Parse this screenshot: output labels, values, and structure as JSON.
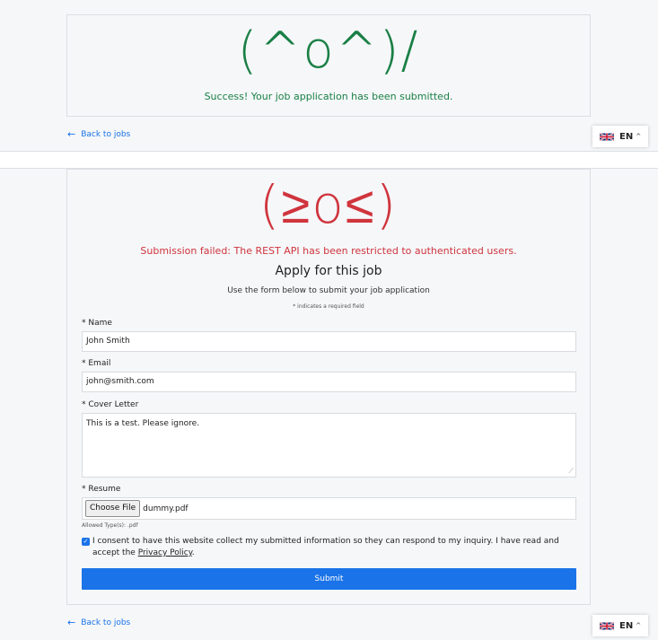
{
  "success_panel": {
    "emoticon": "(^o^)/",
    "message": "Success! Your job application has been submitted."
  },
  "fail_panel": {
    "emoticon": "(≥o≤)",
    "message": "Submission failed: The REST API has been restricted to authenticated users.",
    "title": "Apply for this job",
    "subtitle": "Use the form below to submit your job application",
    "required_note": "* indicates a required field"
  },
  "form": {
    "name_label": "* Name",
    "name_value": "John Smith",
    "email_label": "* Email",
    "email_value": "john@smith.com",
    "cover_label": "* Cover Letter",
    "cover_value": "This is a test. Please ignore.",
    "resume_label": "* Resume",
    "choose_file_label": "Choose File",
    "file_name": "dummy.pdf",
    "allowed_types": "Allowed Type(s): .pdf",
    "consent_text": "I consent to have this website collect my submitted information so they can respond to my inquiry. I have read and accept the",
    "privacy_link": "Privacy Policy",
    "privacy_suffix": ".",
    "consent_checked": true,
    "submit_label": "Submit"
  },
  "nav": {
    "back_link": "Back to jobs"
  },
  "language": {
    "code": "EN",
    "flag": "uk-flag-icon"
  },
  "colors": {
    "success": "#1a7f45",
    "error": "#d0343d",
    "accent": "#1a73e8"
  }
}
